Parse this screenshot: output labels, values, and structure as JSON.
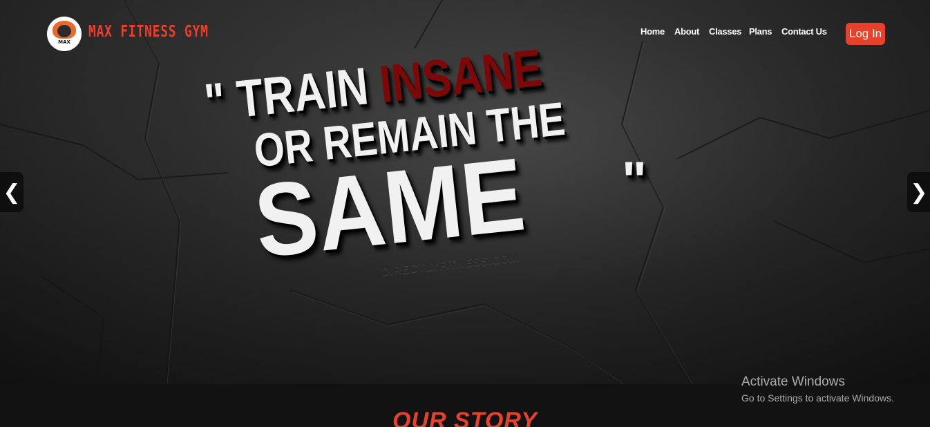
{
  "header": {
    "logo_text": "MAX",
    "brand": "MAX FITNESS GYM",
    "nav": [
      "Home",
      "About",
      "Classes",
      "Plans",
      "Contact Us"
    ],
    "login_label": "Log In"
  },
  "hero": {
    "quote_line1_a": "\" TRAIN ",
    "quote_line1_b": "INSANE",
    "quote_line2": "OR REMAIN THE",
    "quote_line3": "SAME",
    "close_quote": "\"",
    "watermark": "DIRECTLYFITNESS.COM",
    "prev_arrow": "❮",
    "next_arrow": "❯"
  },
  "section": {
    "title": "OUR STORY"
  },
  "overlay": {
    "activate_title": "Activate Windows",
    "activate_sub": "Go to Settings to activate Windows."
  },
  "colors": {
    "accent": "#e8412b",
    "quote_red": "#7e0808",
    "background": "#2b2b2b"
  }
}
